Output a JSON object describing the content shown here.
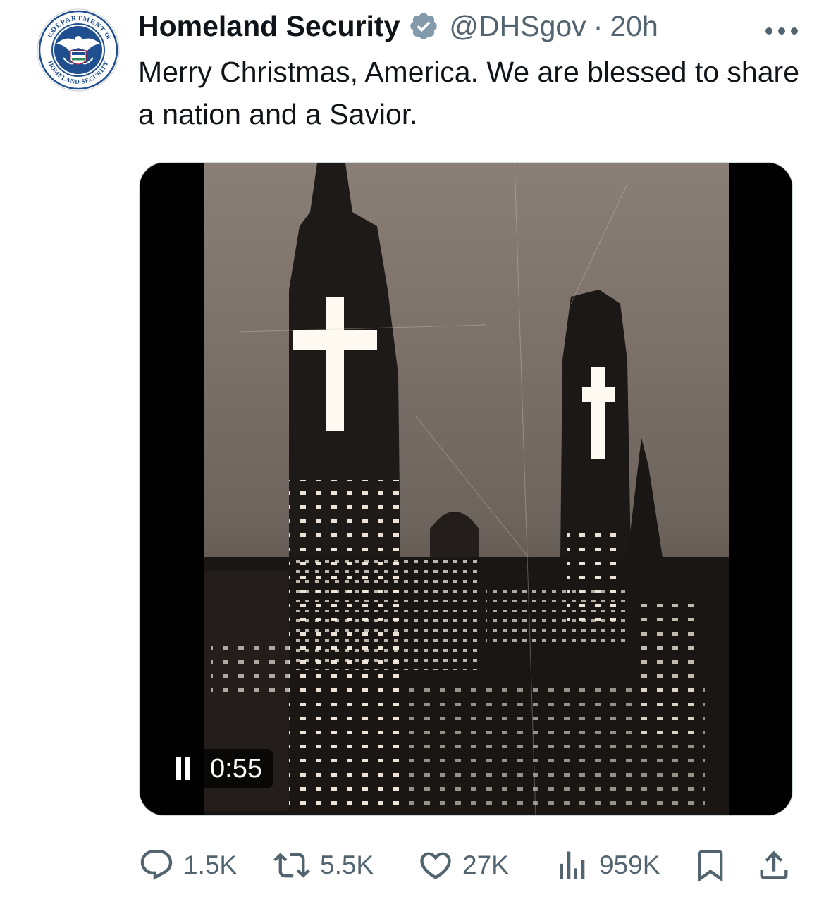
{
  "tweet": {
    "author": {
      "display_name": "Homeland Security",
      "handle": "@DHSgov",
      "separator": "·",
      "time": "20h",
      "avatar_icon": "dhs-seal-icon",
      "avatar_text_top": "DEPARTMENT",
      "avatar_text_bottom": "HOMELAND SECURITY",
      "avatar_text_left": "U.S.",
      "avatar_text_right": "OF",
      "verified_icon": "verified-badge-icon",
      "verified_color": "#829aab"
    },
    "text": "Merry Christmas, America. We are blessed to share a nation and a Savior.",
    "media": {
      "type": "video",
      "playback_icon": "pause-icon",
      "duration": "0:55",
      "scene": "sepia-city-skyline-with-cross-lit-skyscrapers"
    },
    "more_icon": "more-options-icon"
  },
  "actions": {
    "reply": {
      "icon": "reply-icon",
      "count": "1.5K"
    },
    "repost": {
      "icon": "repost-icon",
      "count": "5.5K"
    },
    "like": {
      "icon": "heart-icon",
      "count": "27K"
    },
    "views": {
      "icon": "views-icon",
      "count": "959K"
    },
    "bookmark": {
      "icon": "bookmark-icon"
    },
    "share": {
      "icon": "share-icon"
    }
  },
  "colors": {
    "text_primary": "#0f1419",
    "text_secondary": "#536471",
    "border": "#cfd9de",
    "seal_blue": "#1f4f8f"
  }
}
